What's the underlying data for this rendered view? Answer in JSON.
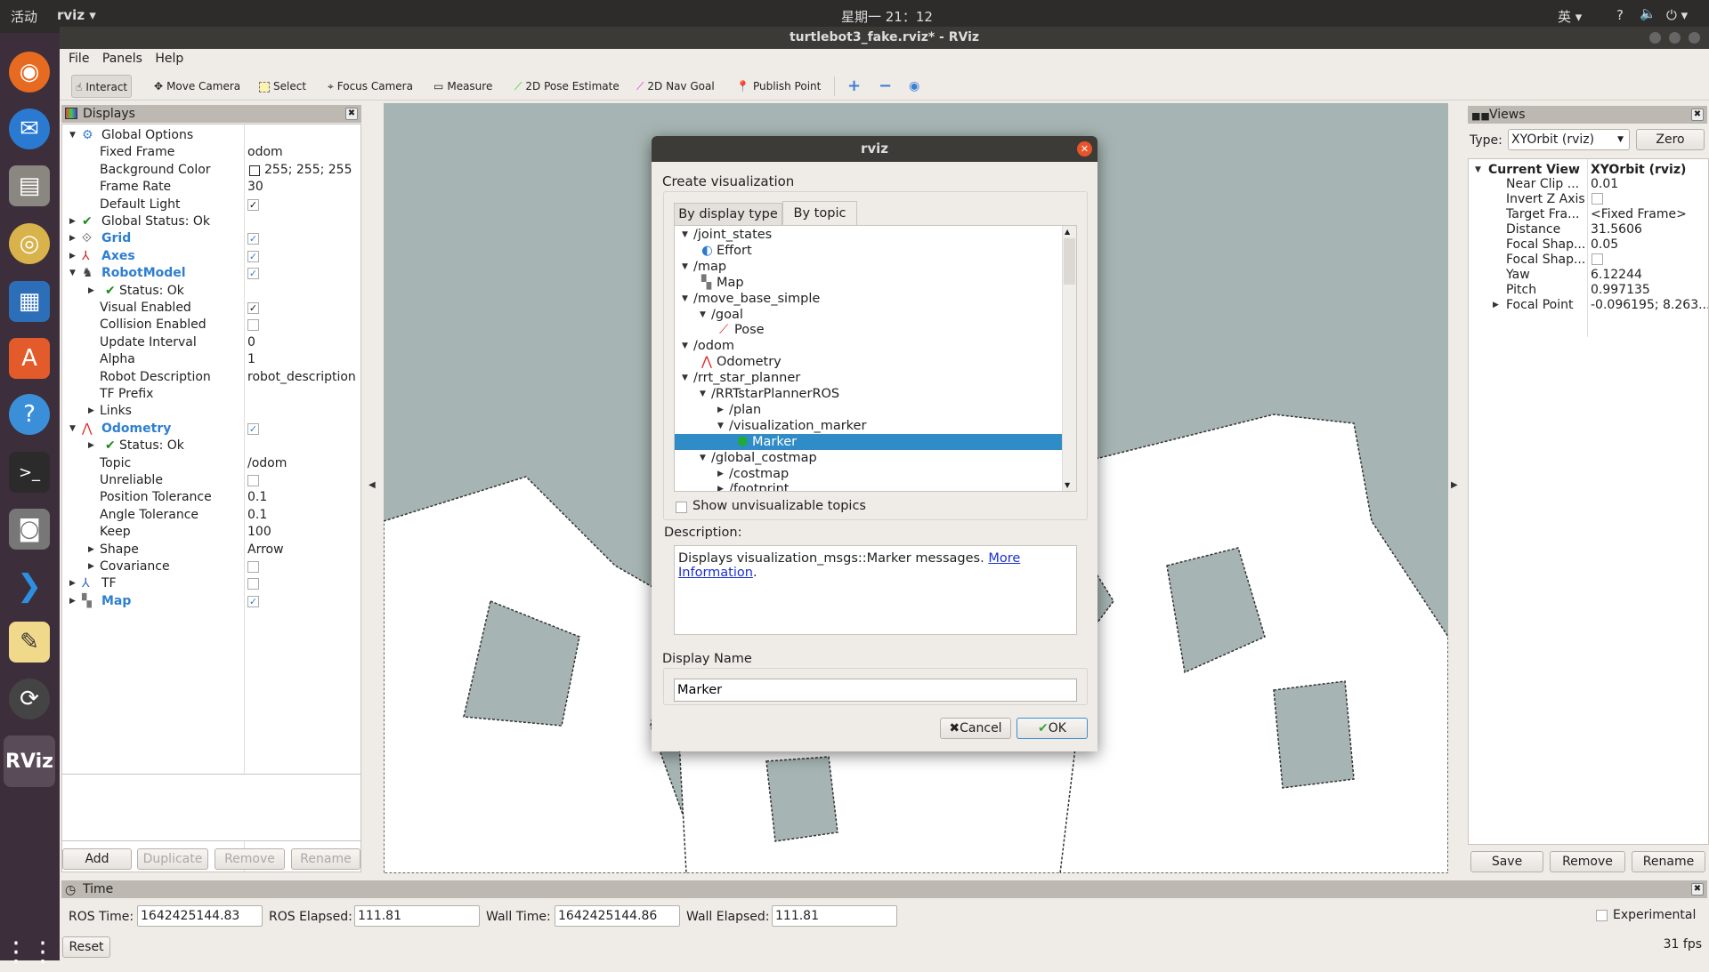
{
  "topbar": {
    "activities": "活动",
    "app_menu": "rviz ▾",
    "clock": "星期一 21：12",
    "input_method": "英 ▾",
    "help": "?",
    "volume_icon": "volume-icon",
    "power": "⏻ ▾"
  },
  "window": {
    "title": "turtlebot3_fake.rviz* - RViz"
  },
  "menu": [
    "File",
    "Panels",
    "Help"
  ],
  "toolbar": [
    {
      "label": "Interact",
      "icon": "hand-icon",
      "pressed": true
    },
    {
      "label": "Move Camera",
      "icon": "move-camera-icon"
    },
    {
      "label": "Select",
      "icon": "select-icon"
    },
    {
      "label": "Focus Camera",
      "icon": "focus-camera-icon"
    },
    {
      "label": "Measure",
      "icon": "ruler-icon"
    },
    {
      "label": "2D Pose Estimate",
      "icon": "green-arrow-icon"
    },
    {
      "label": "2D Nav Goal",
      "icon": "pink-arrow-icon"
    },
    {
      "label": "Publish Point",
      "icon": "map-pin-icon"
    }
  ],
  "displays": {
    "title": "Displays",
    "rows": [
      {
        "d": 0,
        "arrow": "open",
        "icon": "gear",
        "label": "Global Options"
      },
      {
        "d": 1,
        "label": "Fixed Frame",
        "value": "odom"
      },
      {
        "d": 1,
        "label": "Background Color",
        "value": "255; 255; 255",
        "swatch": "#ffffff"
      },
      {
        "d": 1,
        "label": "Frame Rate",
        "value": "30"
      },
      {
        "d": 1,
        "label": "Default Light",
        "check": true
      },
      {
        "d": 0,
        "arrow": "closed",
        "icon": "ok",
        "label": "Global Status: Ok"
      },
      {
        "d": 0,
        "arrow": "closed",
        "icon": "grid",
        "label": "Grid",
        "blue": true,
        "check": true
      },
      {
        "d": 0,
        "arrow": "closed",
        "icon": "axes",
        "label": "Axes",
        "blue": true,
        "check": true
      },
      {
        "d": 0,
        "arrow": "open",
        "icon": "robot",
        "label": "RobotModel",
        "blue": true,
        "check": true
      },
      {
        "d": 1,
        "arrow": "closed",
        "icon": "ok",
        "label": "Status: Ok"
      },
      {
        "d": 1,
        "label": "Visual Enabled",
        "check": true
      },
      {
        "d": 1,
        "label": "Collision Enabled",
        "check": false
      },
      {
        "d": 1,
        "label": "Update Interval",
        "value": "0"
      },
      {
        "d": 1,
        "label": "Alpha",
        "value": "1"
      },
      {
        "d": 1,
        "label": "Robot Description",
        "value": "robot_description"
      },
      {
        "d": 1,
        "label": "TF Prefix"
      },
      {
        "d": 1,
        "arrow": "closed",
        "label": "Links"
      },
      {
        "d": 0,
        "arrow": "open",
        "icon": "odom",
        "label": "Odometry",
        "blue": true,
        "check": true
      },
      {
        "d": 1,
        "arrow": "closed",
        "icon": "ok",
        "label": "Status: Ok"
      },
      {
        "d": 1,
        "label": "Topic",
        "value": "/odom"
      },
      {
        "d": 1,
        "label": "Unreliable",
        "check": false
      },
      {
        "d": 1,
        "label": "Position Tolerance",
        "value": "0.1"
      },
      {
        "d": 1,
        "label": "Angle Tolerance",
        "value": "0.1"
      },
      {
        "d": 1,
        "label": "Keep",
        "value": "100"
      },
      {
        "d": 1,
        "arrow": "closed",
        "label": "Shape",
        "value": "Arrow"
      },
      {
        "d": 1,
        "arrow": "closed",
        "label": "Covariance",
        "check": false
      },
      {
        "d": 0,
        "arrow": "closed",
        "icon": "tf",
        "label": "TF",
        "check": false
      },
      {
        "d": 0,
        "arrow": "closed",
        "icon": "map",
        "label": "Map",
        "blue": true,
        "check": true
      }
    ],
    "buttons": [
      "Add",
      "Duplicate",
      "Remove",
      "Rename"
    ]
  },
  "views": {
    "title": "Views",
    "type_label": "Type:",
    "type_value": "XYOrbit (rviz)",
    "zero": "Zero",
    "header": {
      "label": "Current View",
      "value": "XYOrbit (rviz)"
    },
    "rows": [
      {
        "label": "Near Clip ...",
        "value": "0.01"
      },
      {
        "label": "Invert Z Axis",
        "check": false
      },
      {
        "label": "Target Fra...",
        "value": "<Fixed Frame>"
      },
      {
        "label": "Distance",
        "value": "31.5606"
      },
      {
        "label": "Focal Shap...",
        "value": "0.05"
      },
      {
        "label": "Focal Shap...",
        "check": false
      },
      {
        "label": "Yaw",
        "value": "6.12244"
      },
      {
        "label": "Pitch",
        "value": "0.997135"
      },
      {
        "label": "Focal Point",
        "value": "-0.096195; 8.263...",
        "arrow": "closed"
      }
    ],
    "buttons": [
      "Save",
      "Remove",
      "Rename"
    ]
  },
  "time": {
    "title": "Time",
    "ros_time_label": "ROS Time:",
    "ros_time": "1642425144.83",
    "ros_elapsed_label": "ROS Elapsed:",
    "ros_elapsed": "111.81",
    "wall_time_label": "Wall Time:",
    "wall_time": "1642425144.86",
    "wall_elapsed_label": "Wall Elapsed:",
    "wall_elapsed": "111.81",
    "reset": "Reset",
    "experimental": "Experimental",
    "fps": "31 fps"
  },
  "dialog": {
    "title": "rviz",
    "heading": "Create visualization",
    "tabs": [
      {
        "label": "By display type"
      },
      {
        "label": "By topic",
        "active": true
      }
    ],
    "tree": [
      {
        "d": 0,
        "arrow": "open",
        "label": "/joint_states"
      },
      {
        "d": 1,
        "icon": "effort",
        "label": "Effort"
      },
      {
        "d": 0,
        "arrow": "open",
        "label": "/map"
      },
      {
        "d": 1,
        "icon": "map",
        "label": "Map"
      },
      {
        "d": 0,
        "arrow": "open",
        "label": "/move_base_simple"
      },
      {
        "d": 1,
        "arrow": "open",
        "label": "/goal"
      },
      {
        "d": 2,
        "icon": "pose",
        "label": "Pose"
      },
      {
        "d": 0,
        "arrow": "open",
        "label": "/odom"
      },
      {
        "d": 1,
        "icon": "odom",
        "label": "Odometry"
      },
      {
        "d": 0,
        "arrow": "open",
        "label": "/rrt_star_planner"
      },
      {
        "d": 1,
        "arrow": "open",
        "label": "/RRTstarPlannerROS"
      },
      {
        "d": 2,
        "arrow": "closed",
        "label": "/plan"
      },
      {
        "d": 2,
        "arrow": "open",
        "label": "/visualization_marker"
      },
      {
        "d": 3,
        "icon": "marker",
        "label": "Marker",
        "selected": true
      },
      {
        "d": 1,
        "arrow": "open",
        "label": "/global_costmap"
      },
      {
        "d": 2,
        "arrow": "closed",
        "label": "/costmap"
      },
      {
        "d": 2,
        "arrow": "closed",
        "label": "/footprint"
      }
    ],
    "show_unvisualizable": "Show unvisualizable topics",
    "description_label": "Description:",
    "description_text": "Displays visualization_msgs::Marker messages. ",
    "description_link": "More Information",
    "description_end": ".",
    "display_name_label": "Display Name",
    "display_name": "Marker",
    "cancel": "Cancel",
    "ok": "OK"
  },
  "colors": {
    "selection": "#308cc6",
    "display_blue": "#2f7fd1",
    "viewport_bg": "#a6b5b3"
  }
}
